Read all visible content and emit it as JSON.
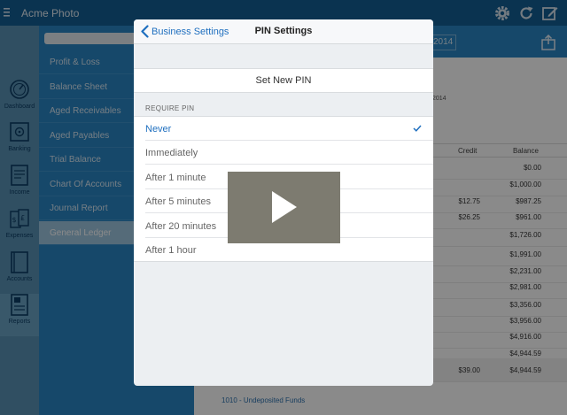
{
  "app": {
    "title": "Acme Photo"
  },
  "topbar_icons": [
    "settings-gear-icon",
    "refresh-icon",
    "compose-icon"
  ],
  "rail": {
    "items": [
      {
        "label": "Dashboard",
        "icon": "gauge-icon"
      },
      {
        "label": "Banking",
        "icon": "safe-icon"
      },
      {
        "label": "Income",
        "icon": "invoice-icon"
      },
      {
        "label": "Expenses",
        "icon": "currency-icon"
      },
      {
        "label": "Accounts",
        "icon": "book-icon"
      },
      {
        "label": "Reports",
        "icon": "report-icon"
      }
    ],
    "active": "Reports"
  },
  "menu": {
    "search_placeholder": "",
    "items": [
      {
        "label": "Profit & Loss"
      },
      {
        "label": "Balance Sheet"
      },
      {
        "label": "Aged Receivables"
      },
      {
        "label": "Aged Payables"
      },
      {
        "label": "Trial Balance"
      },
      {
        "label": "Chart Of Accounts"
      },
      {
        "label": "Journal Report"
      },
      {
        "label": "General Ledger"
      }
    ],
    "active": "General Ledger"
  },
  "main": {
    "date_fragment": "2014",
    "note_fragment": "2014",
    "columns": {
      "credit": "Credit",
      "balance": "Balance"
    },
    "rows": [
      {
        "credit": "",
        "balance": "$0.00"
      },
      {
        "credit": "",
        "balance": "$1,000.00"
      },
      {
        "credit": "$12.75",
        "balance": "$987.25"
      },
      {
        "credit": "$26.25",
        "balance": "$961.00"
      },
      {
        "credit": "",
        "balance": "$1,726.00"
      },
      {
        "credit": "",
        "balance": "$1,991.00"
      },
      {
        "credit": "",
        "balance": "$2,231.00"
      },
      {
        "credit": "",
        "balance": "$2,981.00"
      },
      {
        "credit": "",
        "balance": "$3,356.00"
      },
      {
        "credit": "",
        "balance": "$3,956.00"
      },
      {
        "credit": "",
        "balance": "$4,916.00"
      },
      {
        "credit": "",
        "balance": "$4,944.59"
      }
    ],
    "total": {
      "credit": "$39.00",
      "balance": "$4,944.59"
    },
    "next_account": "1010 - Undeposited Funds"
  },
  "modal": {
    "back_label": "Business Settings",
    "title": "PIN Settings",
    "set_new_pin": "Set New PIN",
    "section_header": "REQUIRE PIN",
    "options": [
      {
        "label": "Never",
        "selected": true
      },
      {
        "label": "Immediately",
        "selected": false
      },
      {
        "label": "After 1 minute",
        "selected": false
      },
      {
        "label": "After 5 minutes",
        "selected": false
      },
      {
        "label": "After 20 minutes",
        "selected": false
      },
      {
        "label": "After 1 hour",
        "selected": false
      }
    ]
  },
  "colors": {
    "topbar": "#145f95",
    "menu": "#2986c4",
    "accent": "#1f6fbf"
  }
}
